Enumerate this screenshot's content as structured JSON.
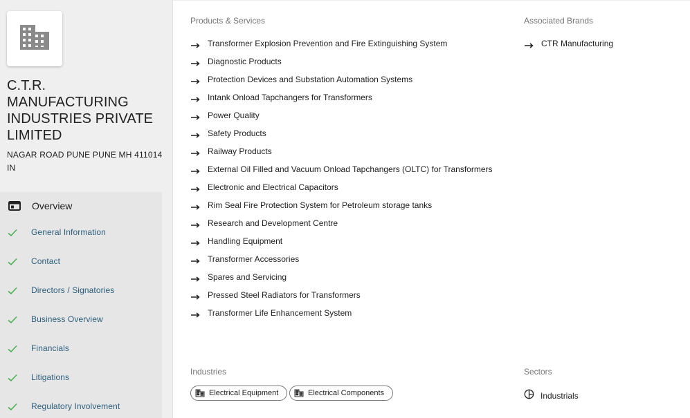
{
  "company": {
    "name": "C.T.R. MANUFACTURING INDUSTRIES PRIVATE LIMITED",
    "address_line1": "NAGAR ROAD PUNE PUNE MH 411014",
    "address_line2": "IN",
    "logo_icon": "building-icon"
  },
  "nav": {
    "overview_label": "Overview",
    "overview_icon": "overview-panel-icon",
    "items": [
      {
        "label": "General Information",
        "icon": "check-icon"
      },
      {
        "label": "Contact",
        "icon": "check-icon"
      },
      {
        "label": "Directors / Signatories",
        "icon": "check-icon"
      },
      {
        "label": "Business Overview",
        "icon": "check-icon"
      },
      {
        "label": "Financials",
        "icon": "check-icon"
      },
      {
        "label": "Litigations",
        "icon": "check-icon"
      },
      {
        "label": "Regulatory Involvement",
        "icon": "check-icon"
      }
    ]
  },
  "products": {
    "title": "Products & Services",
    "items": [
      "Transformer Explosion Prevention and Fire Extinguishing System",
      "Diagnostic Products",
      "Protection Devices and Substation Automation Systems",
      "Intank Onload Tapchangers for Transformers",
      "Power Quality",
      "Safety Products",
      "Railway Products",
      "External Oil Filled and Vacuum Onload Tapchangers (OLTC) for Transformers",
      "Electronic and Electrical Capacitors",
      "Rim Seal Fire Protection System for Petroleum storage tanks",
      "Research and Development Centre",
      "Handling Equipment",
      "Transformer Accessories",
      "Spares and Servicing",
      "Pressed Steel Radiators for Transformers",
      "Transformer Life Enhancement System"
    ]
  },
  "brands": {
    "title": "Associated Brands",
    "items": [
      "CTR Manufacturing"
    ]
  },
  "industries": {
    "title": "Industries",
    "items": [
      "Electrical Equipment",
      "Electrical Components"
    ]
  },
  "sectors": {
    "title": "Sectors",
    "items": [
      "Industrials"
    ]
  },
  "colors": {
    "sidebar_bg": "#efefef",
    "nav_bg": "#e6e6e6",
    "nav_link": "#2c5f7c",
    "check": "#4caf50"
  }
}
